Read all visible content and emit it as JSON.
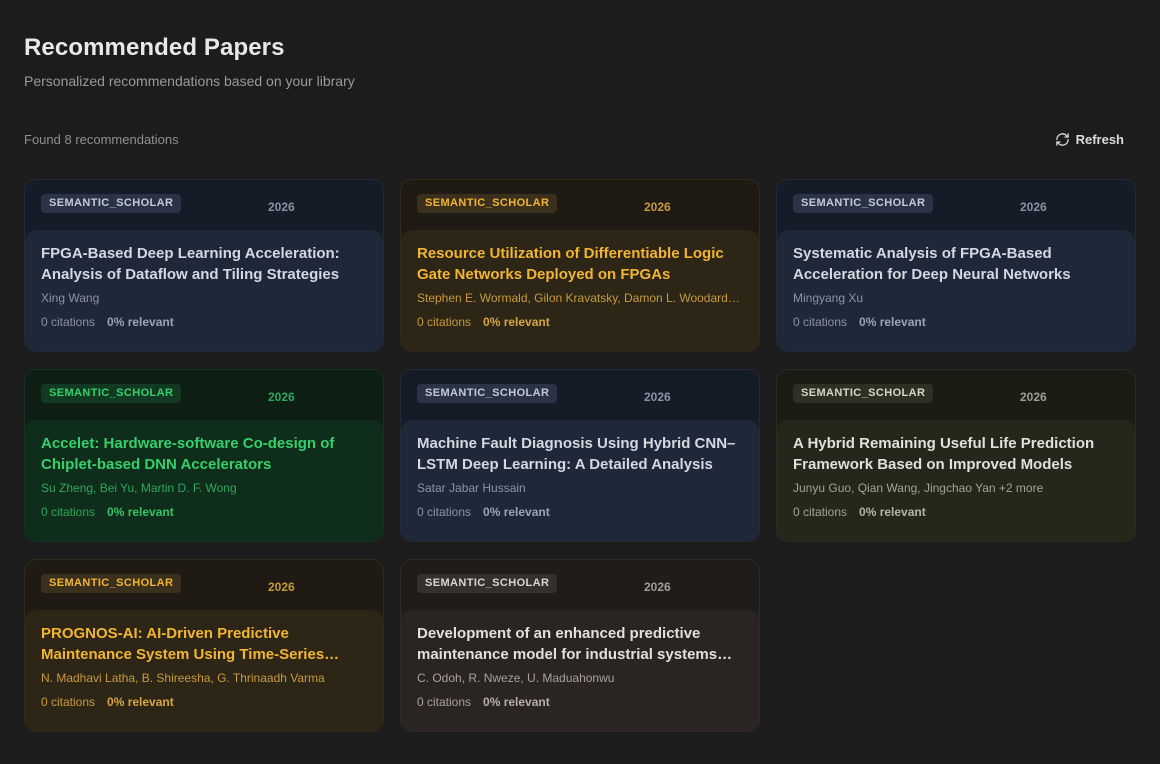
{
  "header": {
    "title": "Recommended Papers",
    "subtitle": "Personalized recommendations based on your library"
  },
  "toolbar": {
    "count_text": "Found 8 recommendations",
    "refresh_label": "Refresh",
    "refresh_icon": "refresh-icon"
  },
  "themes": {
    "blue": "#1f2838",
    "amber": "#f2b533",
    "green": "#35d06c",
    "olive": "#25271b",
    "brown": "#2a2522"
  },
  "papers": [
    {
      "source": "SEMANTIC_SCHOLAR",
      "year": "2026",
      "title": "FPGA-Based Deep Learning Acceleration: Analysis of Dataflow and Tiling Strategies",
      "authors": "Xing Wang",
      "citations": "0 citations",
      "relevance": "0% relevant",
      "theme": "blue"
    },
    {
      "source": "SEMANTIC_SCHOLAR",
      "year": "2026",
      "title": "Resource Utilization of Differentiable Logic Gate Networks Deployed on FPGAs",
      "authors": "Stephen E. Wormald, Gilon Kravatsky, Damon L. Woodard, Domenic Forte",
      "citations": "0 citations",
      "relevance": "0% relevant",
      "theme": "amber"
    },
    {
      "source": "SEMANTIC_SCHOLAR",
      "year": "2026",
      "title": "Systematic Analysis of FPGA-Based Acceleration for Deep Neural Networks",
      "authors": "Mingyang Xu",
      "citations": "0 citations",
      "relevance": "0% relevant",
      "theme": "blue"
    },
    {
      "source": "SEMANTIC_SCHOLAR",
      "year": "2026",
      "title": "Accelet: Hardware-software Co-design of Chiplet-based DNN Accelerators",
      "authors": "Su Zheng, Bei Yu, Martin D. F. Wong",
      "citations": "0 citations",
      "relevance": "0% relevant",
      "theme": "green"
    },
    {
      "source": "SEMANTIC_SCHOLAR",
      "year": "2026",
      "title": "Machine Fault Diagnosis Using Hybrid CNN–LSTM Deep Learning: A Detailed Analysis",
      "authors": "Satar Jabar Hussain",
      "citations": "0 citations",
      "relevance": "0% relevant",
      "theme": "blue"
    },
    {
      "source": "SEMANTIC_SCHOLAR",
      "year": "2026",
      "title": "A Hybrid Remaining Useful Life Prediction Framework Based on Improved Models",
      "authors": "Junyu Guo, Qian Wang, Jingchao Yan +2 more",
      "citations": "0 citations",
      "relevance": "0% relevant",
      "theme": "olive"
    },
    {
      "source": "SEMANTIC_SCHOLAR",
      "year": "2026",
      "title": "PROGNOS-AI: AI-Driven Predictive Maintenance System Using Time-Series Analysis",
      "authors": "N. Madhavi Latha, B. Shireesha, G. Thrinaadh Varma",
      "citations": "0 citations",
      "relevance": "0% relevant",
      "theme": "amber"
    },
    {
      "source": "SEMANTIC_SCHOLAR",
      "year": "2026",
      "title": "Development of an enhanced predictive maintenance model for industrial systems using machine learning",
      "authors": "C. Odoh, R. Nweze, U. Maduahonwu",
      "citations": "0 citations",
      "relevance": "0% relevant",
      "theme": "brown"
    }
  ]
}
